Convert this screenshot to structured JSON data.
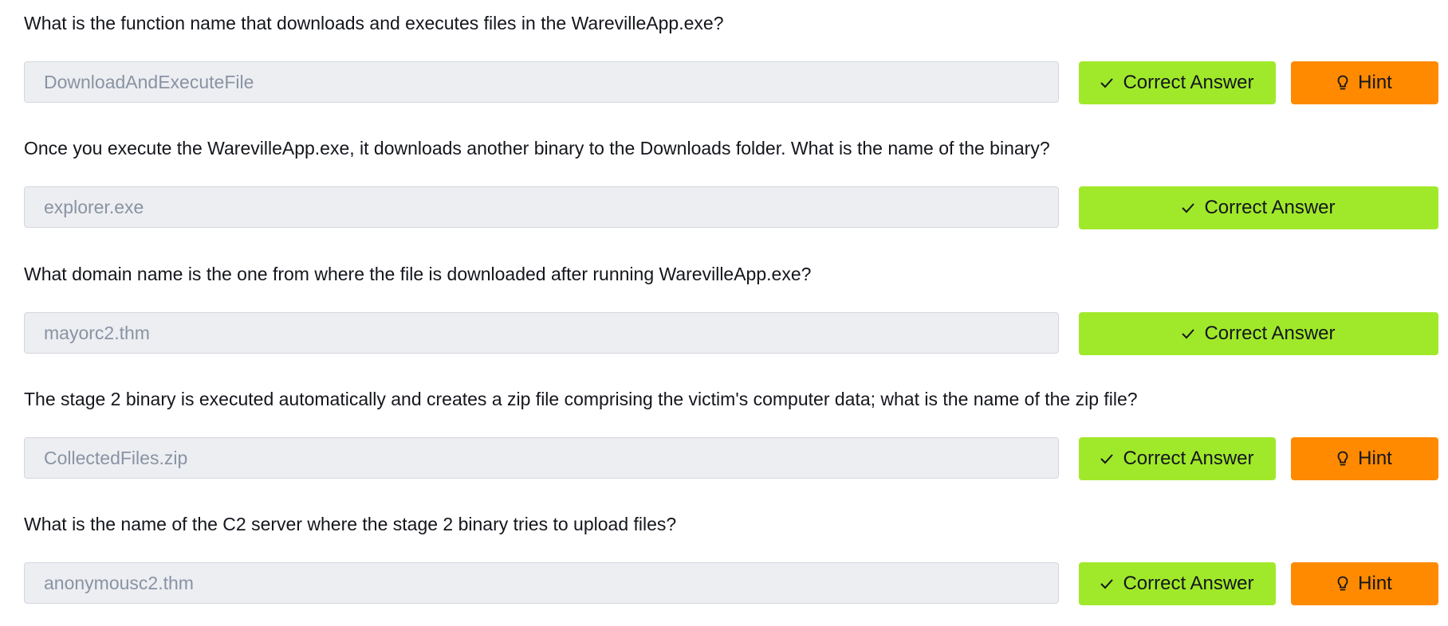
{
  "questions": [
    {
      "question": "What is the function name that downloads and executes files in the WarevilleApp.exe?",
      "answer": "DownloadAndExecuteFile",
      "correct_label": "Correct Answer",
      "hint_label": "Hint"
    },
    {
      "question": "Once you execute the WarevilleApp.exe, it downloads another binary to the Downloads folder. What is the name of the binary?",
      "answer": "explorer.exe",
      "correct_label": "Correct Answer"
    },
    {
      "question": "What domain name is the one from where the file is downloaded after running WarevilleApp.exe?",
      "answer": "mayorc2.thm",
      "correct_label": "Correct Answer"
    },
    {
      "question": "The stage 2 binary is executed automatically and creates a zip file comprising the victim's computer data; what is the name of the zip file?",
      "answer": "CollectedFiles.zip",
      "correct_label": "Correct Answer",
      "hint_label": "Hint"
    },
    {
      "question": "What is the name of the C2 server where the stage 2 binary tries to upload files?",
      "answer": "anonymousc2.thm",
      "correct_label": "Correct Answer",
      "hint_label": "Hint"
    }
  ],
  "icons": {
    "correct": "check-icon",
    "hint": "lightbulb-icon"
  },
  "colors": {
    "correct_button": "#a0e92a",
    "hint_button": "#ff8a00",
    "input_background": "#eceef2",
    "input_text": "#8a93a3"
  }
}
